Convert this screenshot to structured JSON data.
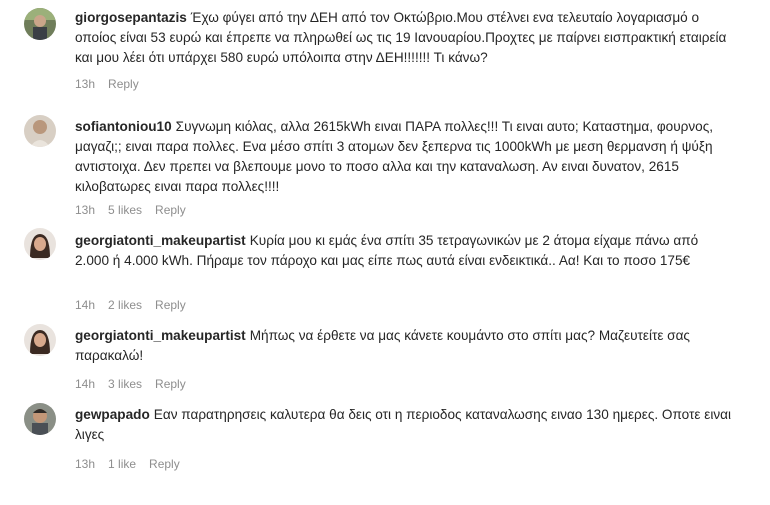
{
  "comments": [
    {
      "username": "giorgosepantazis",
      "text": "Έχω φύγει από την ΔΕΗ από τον Οκτώβριο.Μου στέλνει ενα τελευταίο λογαριασμό ο οποίος είναι 53 ευρώ και έπρεπε να πληρωθεί ως τις 19 Ιανουαρίου.Προχτες με παίρνει εισπρακτική εταιρεία και μου λέει ότι υπάρχει 580 ευρώ υπόλοιπα στην ΔΕΗ!!!!!!! Τι κάνω?",
      "time": "13h",
      "likes": "",
      "reply": "Reply"
    },
    {
      "username": "sofiantoniou10",
      "text": "Συγνωμη κιόλας, αλλα 2615kWh ειναι ΠΑΡΑ πολλες!!! Τι ειναι αυτο; Καταστημα, φουρνος, μαγαζι;; ειναι παρα πολλες. Ενα μέσο σπίτι 3 ατομων δεν ξεπερνα τις 1000kWh με μεση θερμανση ή ψύξη αντιστοιχα. Δεν πρεπει να βλεπουμε μονο το ποσο αλλα και την καταναλωση. Αν ειναι δυνατον, 2615 κιλοβατωρες ειναι παρα πολλες!!!!",
      "time": "13h",
      "likes": "5 likes",
      "reply": "Reply"
    },
    {
      "username": "georgiatonti_makeupartist",
      "text": "Κυρία μου κι εμάς ένα σπίτι 35 τετραγωνικών με 2 άτομα είχαμε πάνω από 2.000 ή 4.000 kWh. Πήραμε τον πάροχο και μας είπε πως αυτά είναι ενδεικτικά.. Αα! Και το ποσο 175€",
      "time": "14h",
      "likes": "2 likes",
      "reply": "Reply"
    },
    {
      "username": "georgiatonti_makeupartist",
      "text": "Μήπως να έρθετε να μας κάνετε κουμάντο στο σπίτι μας? Μαζευτείτε σας παρακαλώ!",
      "time": "14h",
      "likes": "3 likes",
      "reply": "Reply"
    },
    {
      "username": "gewpapado",
      "text": "Εαν παρατηρησεις καλυτερα θα δεις οτι η περιοδος καταναλωσης ειναο 130 ημερες. Οποτε ειναι λιγες",
      "time": "13h",
      "likes": "1 like",
      "reply": "Reply"
    }
  ]
}
